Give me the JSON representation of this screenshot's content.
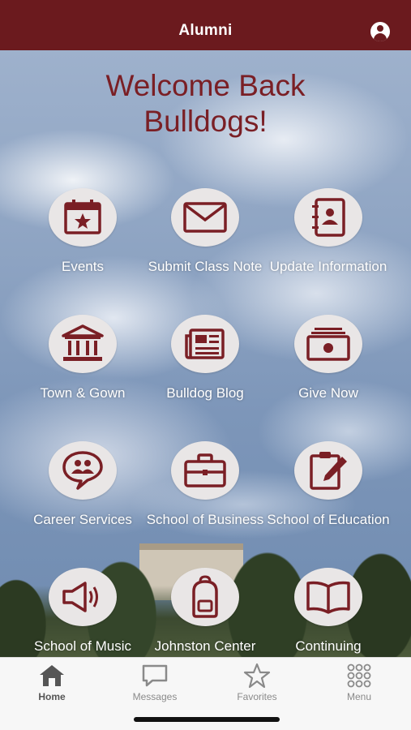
{
  "header": {
    "title": "Alumni",
    "profile_icon": "account-icon"
  },
  "hero": {
    "welcome_line1": "Welcome Back",
    "welcome_line2": "Bulldogs!"
  },
  "tiles": [
    {
      "label": "Events",
      "icon": "calendar-star-icon"
    },
    {
      "label": "Submit Class Note",
      "icon": "envelope-icon"
    },
    {
      "label": "Update Information",
      "icon": "address-book-icon"
    },
    {
      "label": "Town & Gown",
      "icon": "building-columns-icon"
    },
    {
      "label": "Bulldog Blog",
      "icon": "newspaper-icon"
    },
    {
      "label": "Give Now",
      "icon": "money-stack-icon"
    },
    {
      "label": "Career Services",
      "icon": "chat-people-icon"
    },
    {
      "label": "School of Business",
      "icon": "briefcase-icon"
    },
    {
      "label": "School of Education",
      "icon": "clipboard-pencil-icon"
    },
    {
      "label": "School of Music",
      "icon": "megaphone-icon"
    },
    {
      "label": "Johnston Center",
      "icon": "backpack-icon"
    },
    {
      "label": "Continuing",
      "icon": "open-book-icon"
    }
  ],
  "tabbar": [
    {
      "label": "Home",
      "icon": "home-icon",
      "active": true
    },
    {
      "label": "Messages",
      "icon": "chat-bubble-icon",
      "active": false
    },
    {
      "label": "Favorites",
      "icon": "star-icon",
      "active": false
    },
    {
      "label": "Menu",
      "icon": "grid-dots-icon",
      "active": false
    }
  ],
  "colors": {
    "brand": "#6b1a1e",
    "accent": "#7a1f25",
    "tile_bg": "#e9e6e6"
  }
}
